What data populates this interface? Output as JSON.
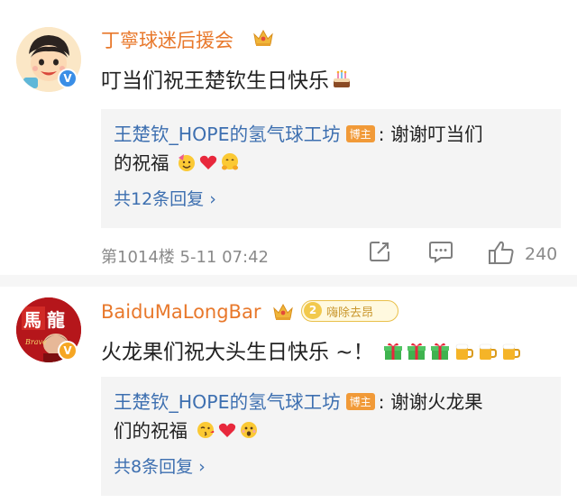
{
  "comments": [
    {
      "username": "丁寧球迷后援会",
      "avatar_icon": "cartoon-avatar",
      "crown_icon": "crown-icon",
      "verified_icon": "verified-v-icon",
      "text": "叮当们祝王楚钦生日快乐",
      "text_emoji": "birthday-cake-icon",
      "reply": {
        "author": "王楚钦_HOPE的氢气球工坊",
        "tag": "博主",
        "line1": ": 谢谢叮当们",
        "line2": "的祝福",
        "emojis": [
          "party-face-icon",
          "red-heart-icon",
          "hug-face-icon"
        ],
        "more": "共12条回复 ›"
      },
      "meta": "第1014楼  5-11 07:42",
      "like_count": "240"
    },
    {
      "username": "BaiduMaLongBar",
      "avatar_icon": "ma-long-avatar",
      "crown_icon": "crown-icon",
      "verified_icon": "verified-v-icon",
      "fan_level": "2",
      "fan_label": "嗨除去昂",
      "text": "火龙果们祝大头生日快乐 ~！",
      "text_emojis": [
        "gift-icon",
        "gift-icon",
        "gift-icon",
        "beer-icon",
        "beer-icon",
        "beer-icon"
      ],
      "reply": {
        "author": "王楚钦_HOPE的氢气球工坊",
        "tag": "博主",
        "line1": ": 谢谢火龙果",
        "line2": "们的祝福",
        "emojis": [
          "kiss-face-icon",
          "red-heart-icon",
          "surprised-face-icon"
        ],
        "more": "共8条回复 ›"
      }
    }
  ],
  "colors": {
    "username": "#e8782b",
    "reply_author": "#3d6fb0",
    "op_tag": "#f19a38",
    "meta": "#8a8a8a",
    "reply_bg": "#f4f4f4"
  }
}
